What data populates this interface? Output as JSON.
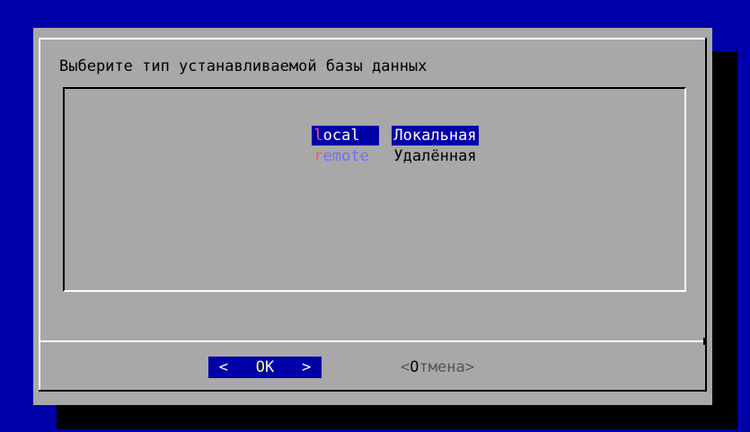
{
  "dialog": {
    "prompt": "Выберите тип устанавливаемой базы данных",
    "options": [
      {
        "tag_hotkey": "l",
        "tag_rest": "ocal",
        "description": "Локальная",
        "selected": true
      },
      {
        "tag_hotkey": "r",
        "tag_rest": "emote",
        "description": "Удалённая",
        "selected": false
      }
    ],
    "buttons": {
      "ok": {
        "left": "<",
        "hotkey": "O",
        "rest": "K",
        "right": ">",
        "focused": true
      },
      "cancel": {
        "left": "<",
        "hotkey": "О",
        "rest": "тмена",
        "right": ">",
        "focused": false
      }
    }
  },
  "colors": {
    "background": "#0000a8",
    "dialog": "#a8a8a8",
    "selection": "#0000a8",
    "hotkey": "#ff5555"
  }
}
